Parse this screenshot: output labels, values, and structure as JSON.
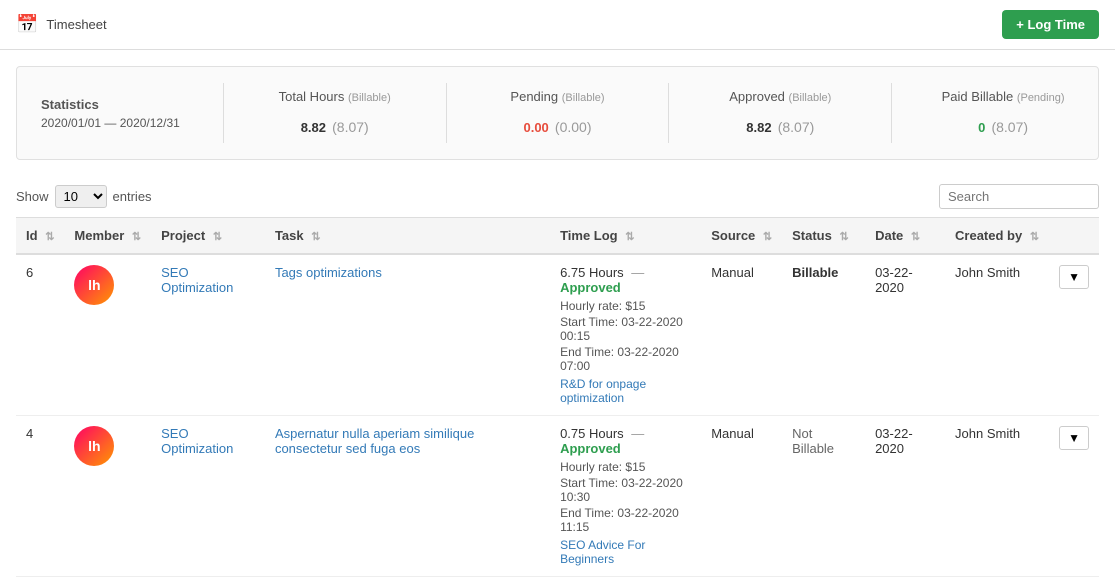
{
  "header": {
    "title": "Timesheet",
    "log_time_button": "+ Log Time",
    "calendar_icon": "📅"
  },
  "stats": {
    "label": "Statistics",
    "date_range": "2020/01/01 — 2020/12/31",
    "total_hours": {
      "title": "Total Hours",
      "sub": "(Billable)",
      "value": "8.82",
      "paren": "(8.07)"
    },
    "pending": {
      "title": "Pending",
      "sub": "(Billable)",
      "value": "0.00",
      "paren": "(0.00)"
    },
    "approved": {
      "title": "Approved",
      "sub": "(Billable)",
      "value": "8.82",
      "paren": "(8.07)"
    },
    "paid_billable": {
      "title": "Paid Billable",
      "sub": "(Pending)",
      "value": "0",
      "paren": "(8.07)"
    }
  },
  "table_controls": {
    "show_label": "Show",
    "entries_label": "entries",
    "search_placeholder": "Search",
    "entries_value": "10"
  },
  "table": {
    "columns": [
      "Id",
      "Member",
      "Project",
      "Task",
      "Time Log",
      "Source",
      "Status",
      "Date",
      "Created by"
    ],
    "rows": [
      {
        "id": "6",
        "avatar_initials": "lh",
        "project": "SEO Optimization",
        "task": "Tags optimizations",
        "time_log_hours": "6.75 Hours",
        "time_log_dash": "—",
        "time_log_status": "Approved",
        "hourly_rate": "Hourly rate: $15",
        "start_time": "Start Time: 03-22-2020 00:15",
        "end_time": "End Time: 03-22-2020 07:00",
        "note": "R&D for onpage optimization",
        "source": "Manual",
        "status": "Billable",
        "date": "03-22-2020",
        "created_by": "John Smith"
      },
      {
        "id": "4",
        "avatar_initials": "lh",
        "project": "SEO Optimization",
        "task": "Aspernatur nulla aperiam similique consectetur sed fuga eos",
        "time_log_hours": "0.75 Hours",
        "time_log_dash": "—",
        "time_log_status": "Approved",
        "hourly_rate": "Hourly rate: $15",
        "start_time": "Start Time: 03-22-2020 10:30",
        "end_time": "End Time: 03-22-2020 11:15",
        "note": "SEO Advice For Beginners",
        "source": "Manual",
        "status": "Not Billable",
        "date": "03-22-2020",
        "created_by": "John Smith"
      }
    ]
  }
}
